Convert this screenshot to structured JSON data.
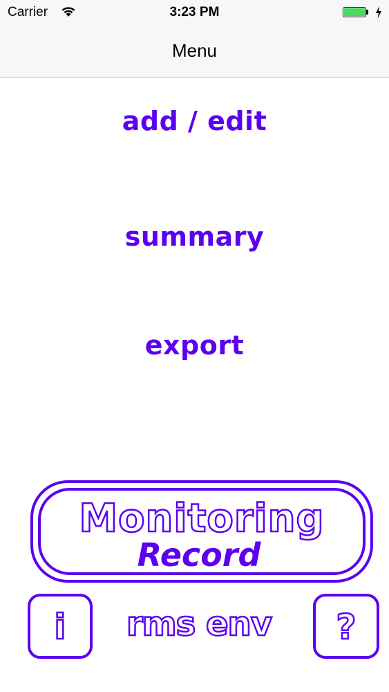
{
  "status_bar": {
    "carrier": "Carrier",
    "time": "3:23 PM",
    "battery_color": "#4cd964"
  },
  "nav": {
    "title": "Menu"
  },
  "menu": {
    "add_edit": "add / edit",
    "summary": "summary",
    "export": "export"
  },
  "logo": {
    "line1": "Monitoring",
    "line2": "Record"
  },
  "footer": {
    "info_symbol": "i",
    "brand": "rms env",
    "help_symbol": "?"
  },
  "colors": {
    "accent": "#5b00f0"
  },
  "icons": [
    "wifi-icon",
    "battery-icon",
    "charging-icon",
    "info-icon",
    "help-icon"
  ]
}
